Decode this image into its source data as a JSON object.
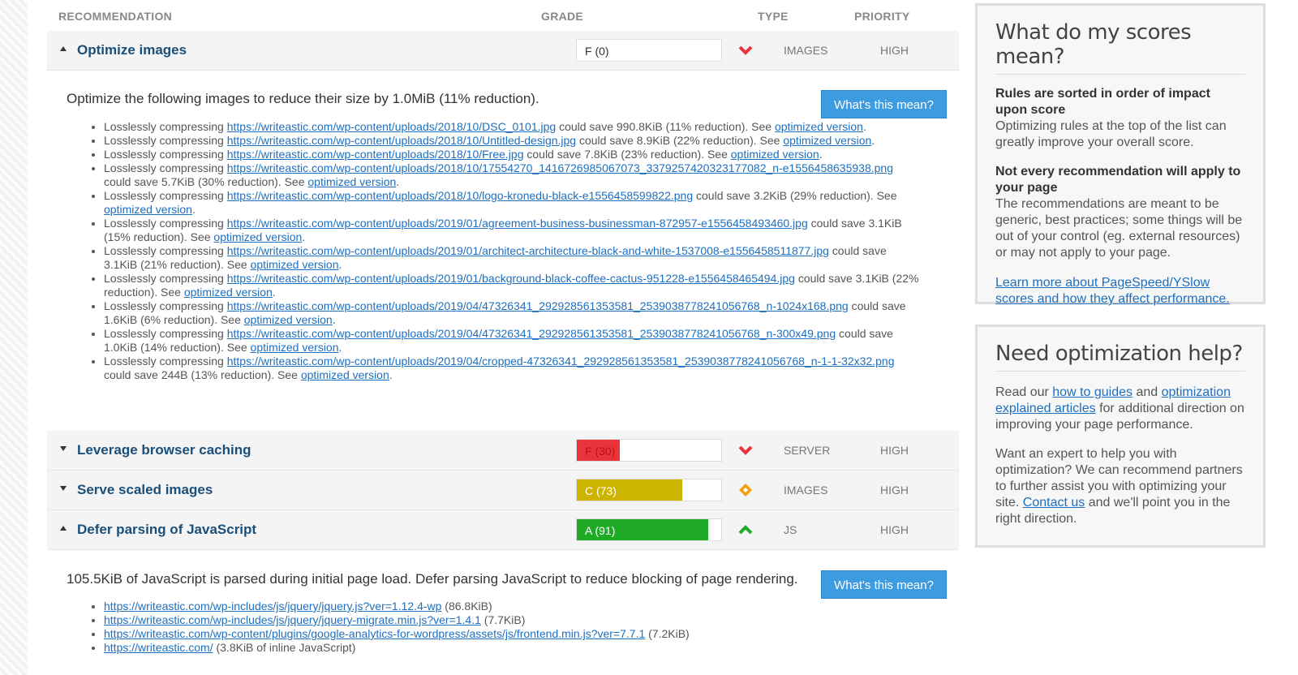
{
  "header": {
    "recommendation": "RECOMMENDATION",
    "grade": "GRADE",
    "type": "TYPE",
    "priority": "PRIORITY"
  },
  "recommendations": [
    {
      "title": "Optimize images",
      "grade": "F (0)",
      "grade_fraction": 0.0,
      "grade_color": "#ffffff",
      "trend": "down",
      "type": "IMAGES",
      "priority": "HIGH",
      "expanded": true,
      "summary": "Optimize the following images to reduce their size by 1.0MiB (11% reduction).",
      "button": "What's this mean?",
      "items": [
        {
          "pre": "Losslessly compressing ",
          "url": "https://writeastic.com/wp-content/uploads/2018/10/DSC_0101.jpg",
          "post": " could save 990.8KiB (11% reduction). See ",
          "link": "optimized version",
          "end": "."
        },
        {
          "pre": "Losslessly compressing ",
          "url": "https://writeastic.com/wp-content/uploads/2018/10/Untitled-design.jpg",
          "post": " could save 8.9KiB (22% reduction). See ",
          "link": "optimized version",
          "end": "."
        },
        {
          "pre": "Losslessly compressing ",
          "url": "https://writeastic.com/wp-content/uploads/2018/10/Free.jpg",
          "post": " could save 7.8KiB (23% reduction). See ",
          "link": "optimized version",
          "end": "."
        },
        {
          "pre": "Losslessly compressing ",
          "url": "https://writeastic.com/wp-content/uploads/2018/10/17554270_1416726985067073_3379257420323177082_n-e1556458635938.png",
          "post": " could save 5.7KiB (30% reduction). See ",
          "link": "optimized version",
          "end": "."
        },
        {
          "pre": "Losslessly compressing ",
          "url": "https://writeastic.com/wp-content/uploads/2018/10/logo-kronedu-black-e1556458599822.png",
          "post": " could save 3.2KiB (29% reduction). See ",
          "link": "optimized version",
          "end": "."
        },
        {
          "pre": "Losslessly compressing ",
          "url": "https://writeastic.com/wp-content/uploads/2019/01/agreement-business-businessman-872957-e1556458493460.jpg",
          "post": " could save 3.1KiB (15% reduction). See ",
          "link": "optimized version",
          "end": "."
        },
        {
          "pre": "Losslessly compressing ",
          "url": "https://writeastic.com/wp-content/uploads/2019/01/architect-architecture-black-and-white-1537008-e1556458511877.jpg",
          "post": " could save 3.1KiB (21% reduction). See ",
          "link": "optimized version",
          "end": "."
        },
        {
          "pre": "Losslessly compressing ",
          "url": "https://writeastic.com/wp-content/uploads/2019/01/background-black-coffee-cactus-951228-e1556458465494.jpg",
          "post": " could save 3.1KiB (22% reduction). See ",
          "link": "optimized version",
          "end": "."
        },
        {
          "pre": "Losslessly compressing ",
          "url": "https://writeastic.com/wp-content/uploads/2019/04/47326341_292928561353581_2539038778241056768_n-1024x168.png",
          "post": " could save 1.6KiB (6% reduction). See ",
          "link": "optimized version",
          "end": "."
        },
        {
          "pre": "Losslessly compressing ",
          "url": "https://writeastic.com/wp-content/uploads/2019/04/47326341_292928561353581_2539038778241056768_n-300x49.png",
          "post": " could save 1.0KiB (14% reduction). See ",
          "link": "optimized version",
          "end": "."
        },
        {
          "pre": "Losslessly compressing ",
          "url": "https://writeastic.com/wp-content/uploads/2019/04/cropped-47326341_292928561353581_2539038778241056768_n-1-1-32x32.png",
          "post": " could save 244B (13% reduction). See ",
          "link": "optimized version",
          "end": "."
        }
      ]
    },
    {
      "title": "Leverage browser caching",
      "grade": "F (30)",
      "grade_fraction": 0.3,
      "grade_color": "#e8343a",
      "trend": "down",
      "type": "SERVER",
      "priority": "HIGH",
      "expanded": false
    },
    {
      "title": "Serve scaled images",
      "grade": "C (73)",
      "grade_fraction": 0.73,
      "grade_color": "#ccb400",
      "trend": "neutral",
      "type": "IMAGES",
      "priority": "HIGH",
      "expanded": false
    },
    {
      "title": "Defer parsing of JavaScript",
      "grade": "A (91)",
      "grade_fraction": 0.91,
      "grade_color": "#1fab26",
      "trend": "up",
      "type": "JS",
      "priority": "HIGH",
      "expanded": true,
      "summary": "105.5KiB of JavaScript is parsed during initial page load. Defer parsing JavaScript to reduce blocking of page rendering.",
      "button": "What's this mean?",
      "items": [
        {
          "pre": "",
          "url": "https://writeastic.com/wp-includes/js/jquery/jquery.js?ver=1.12.4-wp",
          "post": " (86.8KiB)",
          "link": "",
          "end": ""
        },
        {
          "pre": "",
          "url": "https://writeastic.com/wp-includes/js/jquery/jquery-migrate.min.js?ver=1.4.1",
          "post": " (7.7KiB)",
          "link": "",
          "end": ""
        },
        {
          "pre": "",
          "url": "https://writeastic.com/wp-content/plugins/google-analytics-for-wordpress/assets/js/frontend.min.js?ver=7.7.1",
          "post": " (7.2KiB)",
          "link": "",
          "end": ""
        },
        {
          "pre": "",
          "url": "https://writeastic.com/",
          "post": " (3.8KiB of inline JavaScript)",
          "link": "",
          "end": ""
        }
      ]
    }
  ],
  "sidebar": {
    "scores_panel": {
      "title": "What do my scores mean?",
      "h1": "Rules are sorted in order of impact upon score",
      "p1": "Optimizing rules at the top of the list can greatly improve your overall score.",
      "h2": "Not every recommendation will apply to your page",
      "p2": "The recommendations are meant to be generic, best practices; some things will be out of your control (eg. external resources) or may not apply to your page.",
      "link": "Learn more about PageSpeed/YSlow scores and how they affect performance."
    },
    "help_panel": {
      "title": "Need optimization help?",
      "p1_pre": "Read our ",
      "p1_link1": "how to guides",
      "p1_mid": " and ",
      "p1_link2": "optimization explained articles",
      "p1_post": " for additional direction on improving your page performance.",
      "p2_pre": "Want an expert to help you with optimization? We can recommend partners to further assist you with optimizing your site. ",
      "p2_link": "Contact us",
      "p2_post": " and we'll point you in the right direction."
    }
  },
  "colors": {
    "accent_button": "#3d9be0",
    "title_blue": "#1a4f7a",
    "link_blue": "#1d6fbf",
    "trend_down": "#e8343a",
    "trend_neutral": "#f0a010",
    "trend_up": "#1fab26"
  }
}
